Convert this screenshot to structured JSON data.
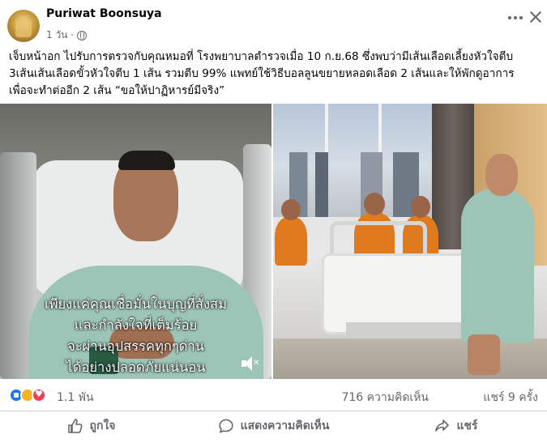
{
  "post": {
    "author": "Puriwat Boonsuya",
    "time": "1 วัน ·",
    "privacy_icon": "globe-icon",
    "text_lines": [
      "เจ็บหน้าอก ไปรับการตรวจกับคุณหมอที่ โรงพยาบาลตำรวจเมื่อ 10 ก.ย.68 ซึ่งพบว่ามีเส้นเลือดเลี้ยงหัวใจตีบ",
      "3เส้นเส้นเลือดขั้วหัวใจตีบ 1 เส้น  รวมตีบ 99% แพทย์ใช้วิธีบอลลูนขยายหลอดเลือด 2 เส้นและให้พักดูอาการ",
      "เพื่อจะทำต่ออีก 2 เส้น “ขอให้ปาฏิหารย์มีจริง”"
    ]
  },
  "video": {
    "caption_lines": [
      "เพียงแค่คุณเชื่อมั่นในบุญที่สั่งสม",
      "และกำลังใจที่เต็มร้อย",
      "จะผ่านอุปสรรคทุกๆด่าน",
      "ได้อย่างปลอดภัยแน่นอน"
    ]
  },
  "stats": {
    "reactions": "1.1 พัน",
    "comments": "716 ความคิดเห็น",
    "shares": "แชร์ 9 ครั้ง"
  },
  "actions": {
    "like": "ถูกใจ",
    "comment": "แสดงความคิดเห็น",
    "share": "แชร์"
  },
  "colors": {
    "accent": "#1877f2",
    "love": "#f33e58",
    "care": "#f7b125",
    "secondary_text": "#65676b"
  }
}
